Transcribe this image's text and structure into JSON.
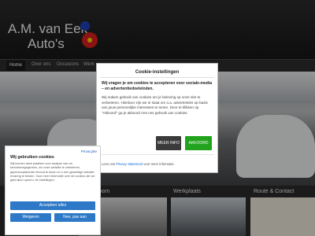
{
  "header": {
    "logo_line1": "A.M. van Eek",
    "logo_line2": "Auto's"
  },
  "nav": {
    "items": [
      "Home",
      "Over ons",
      "Occasions",
      "Werk"
    ]
  },
  "hero": {
    "plate": ""
  },
  "tiles": [
    {
      "title": "rowroom"
    },
    {
      "title": "Werkplaats"
    },
    {
      "title": "Route & Contact"
    }
  ],
  "cookie_modal": {
    "title": "Cookie-instellingen",
    "intro": "Wij vragen je om cookies te accepteren voor sociale-media – en advertentiedoeleinden.",
    "body": "Wij maken gebruik van cookies om je beleving op onze site te verbeteren. Hierdoor zijn we in staat om o.a. advertenties op basis van jouw persoonlijke interesses te tonen. Door te klikken op \"Akkoord\" ga je akkoord met ons gebruik van cookies.",
    "more_button": "MEER INFO",
    "accept_button": "AKKOORD",
    "footer_prefix": "Lees ons",
    "footer_link": "Privacy Statement",
    "footer_suffix": "voor meer informatie."
  },
  "cookie_panel": {
    "privacy_link": "Privacybe",
    "title": "Wij gebruiken cookies",
    "text": "Wij kunnen deze plaatsen voor analyse van uw bezoekersgegevens, om onze website te verbeteren, gepersonaliseerde inhoud te tonen en u een geweldige website-ervaring te bieden. Voor meer informatie over de cookies die we gebruiken opent u de instellingen.",
    "accept_all": "Accepteer alles",
    "deny": "Weigeren",
    "settings": "Nee, pas aan"
  },
  "colors": {
    "accept_green": "#22a31e",
    "blue_button": "#2d79c7",
    "badge_red": "#d6201c",
    "badge_blue": "#1f3fb5"
  }
}
